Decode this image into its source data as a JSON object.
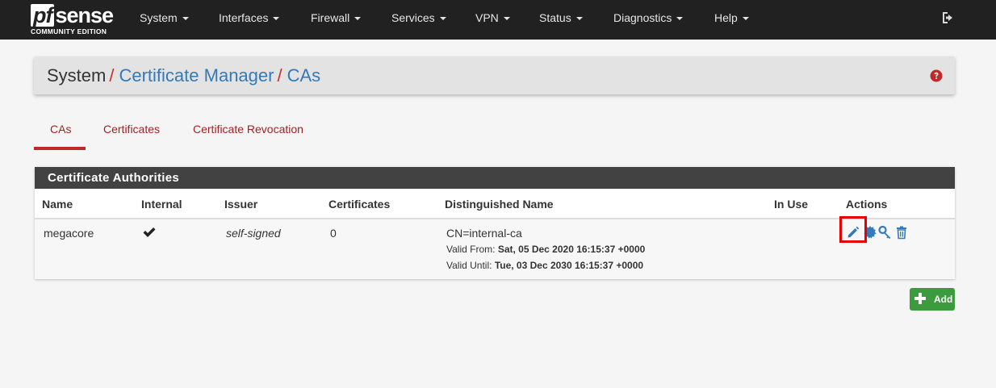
{
  "navbar": {
    "logo_pf": "pf",
    "logo_sense": "sense",
    "logo_edition": "COMMUNITY EDITION",
    "menu": [
      {
        "label": "System"
      },
      {
        "label": "Interfaces"
      },
      {
        "label": "Firewall"
      },
      {
        "label": "Services"
      },
      {
        "label": "VPN"
      },
      {
        "label": "Status"
      },
      {
        "label": "Diagnostics"
      },
      {
        "label": "Help"
      }
    ]
  },
  "breadcrumb": {
    "root": "System",
    "sep": "/",
    "level1": "Certificate Manager",
    "level2": "CAs"
  },
  "tabs": [
    {
      "label": "CAs",
      "active": true
    },
    {
      "label": "Certificates",
      "active": false
    },
    {
      "label": "Certificate Revocation",
      "active": false
    }
  ],
  "panel": {
    "title": "Certificate Authorities",
    "columns": [
      "Name",
      "Internal",
      "Issuer",
      "Certificates",
      "Distinguished Name",
      "In Use",
      "Actions"
    ],
    "rows": [
      {
        "name": "megacore",
        "internal": true,
        "issuer": "self-signed",
        "certificates": "0",
        "dn": "CN=internal-ca",
        "valid_from_label": "Valid From:",
        "valid_from": "Sat, 05 Dec 2020 16:15:37 +0000",
        "valid_until_label": "Valid Until:",
        "valid_until": "Tue, 03 Dec 2030 16:15:37 +0000",
        "in_use": ""
      }
    ]
  },
  "add_button": {
    "label": "Add"
  },
  "colors": {
    "navbar": "#212121",
    "link": "#337ab7",
    "tab": "#9f1f1f",
    "accent_red": "#c0282a",
    "panel_heading": "#424242",
    "action_icon": "#337ab7",
    "add_green": "#3c9b3c",
    "highlight": "#e60000"
  }
}
